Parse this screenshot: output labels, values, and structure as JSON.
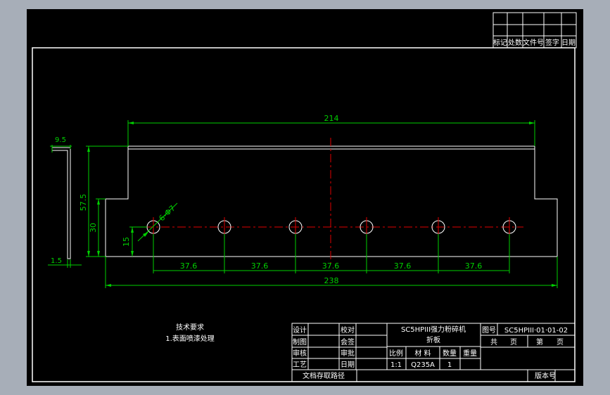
{
  "revision_table": {
    "headers": [
      "标记",
      "处数",
      "文件号",
      "签字",
      "日期"
    ]
  },
  "dimensions": {
    "top_length": "214",
    "total_length": "238",
    "hole_spacing": [
      "37.6",
      "37.6",
      "37.6",
      "37.6",
      "37.6"
    ],
    "height_total": "57.5",
    "height_step": "30",
    "hole_height": "15",
    "hole_callout": "6-Φ7",
    "side_flange": "9.5",
    "side_thickness": "1.5"
  },
  "tech_requirements": {
    "heading": "技术要求",
    "item1": "1.表面喷漆处理"
  },
  "title_block": {
    "labels": {
      "design": "设计",
      "check": "校对",
      "draw": "制图",
      "countersign": "会签",
      "review": "审核",
      "approve": "审批",
      "process": "工艺",
      "date": "日期",
      "scale": "比例",
      "material": "材  料",
      "quantity": "数量",
      "weight": "重量",
      "drawing_no": "图号",
      "total": "共",
      "page": "页",
      "sheet": "第",
      "path": "文档存取路径",
      "version": "版本号"
    },
    "product_name": "SC5HPIII强力粉碎机",
    "part_name": "折板",
    "drawing_number": "SC5HPIII·01·01-02",
    "scale_value": "1:1",
    "material_value": "Q235A",
    "quantity_value": "1"
  }
}
